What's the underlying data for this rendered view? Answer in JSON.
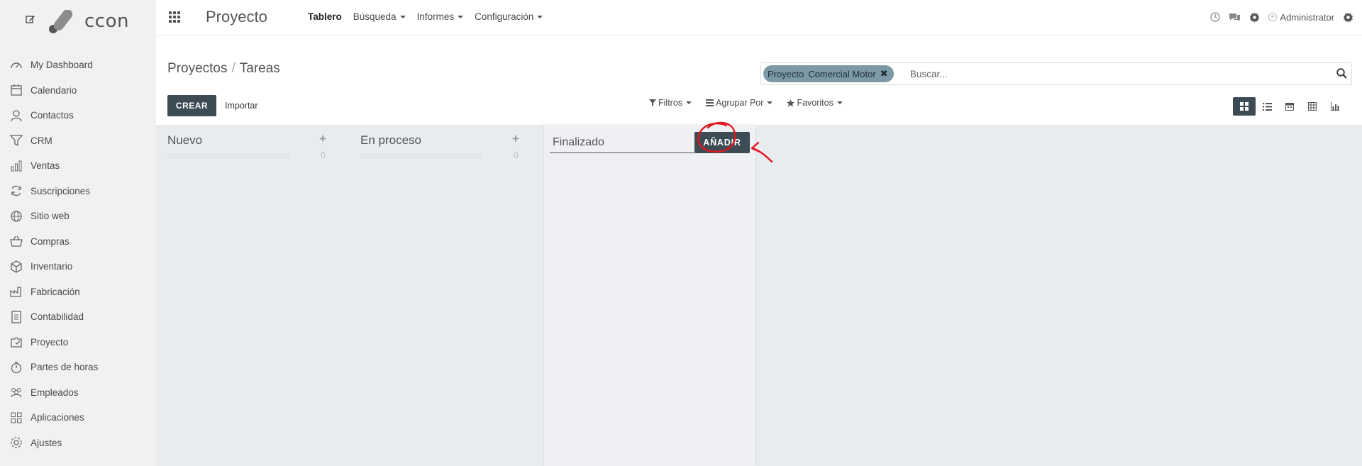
{
  "brand": {
    "logo_text": "ccon"
  },
  "sidebar": {
    "items": [
      {
        "label": "My Dashboard",
        "icon": "dashboard-icon"
      },
      {
        "label": "Calendario",
        "icon": "calendar-icon"
      },
      {
        "label": "Contactos",
        "icon": "user-icon"
      },
      {
        "label": "CRM",
        "icon": "funnel-icon"
      },
      {
        "label": "Ventas",
        "icon": "bar-chart-icon"
      },
      {
        "label": "Suscripciones",
        "icon": "refresh-icon"
      },
      {
        "label": "Sitio web",
        "icon": "globe-icon"
      },
      {
        "label": "Compras",
        "icon": "basket-icon"
      },
      {
        "label": "Inventario",
        "icon": "box-icon"
      },
      {
        "label": "Fabricación",
        "icon": "factory-icon"
      },
      {
        "label": "Contabilidad",
        "icon": "ledger-icon"
      },
      {
        "label": "Proyecto",
        "icon": "puzzle-icon"
      },
      {
        "label": "Partes de horas",
        "icon": "stopwatch-icon"
      },
      {
        "label": "Empleados",
        "icon": "employees-icon"
      },
      {
        "label": "Aplicaciones",
        "icon": "apps-grid-icon"
      },
      {
        "label": "Ajustes",
        "icon": "gear-icon"
      }
    ]
  },
  "topbar": {
    "app_title": "Proyecto",
    "menu": {
      "tablero": "Tablero",
      "busqueda": "Búsqueda",
      "informes": "Informes",
      "configuracion": "Configuración"
    },
    "user": "Administrator"
  },
  "control_panel": {
    "breadcrumb": {
      "parent": "Proyectos",
      "separator": "/",
      "current": "Tareas"
    },
    "search": {
      "facet_title": "Proyecto",
      "facet_value": "Comercial Motor",
      "facet_remove": "✖",
      "placeholder": "Buscar..."
    },
    "create_label": "CREAR",
    "import_label": "Importar",
    "filters_label": "Filtros",
    "group_by_label": "Agrupar Por",
    "favorites_label": "Favoritos"
  },
  "kanban": {
    "columns": [
      {
        "title": "Nuevo",
        "count": "0",
        "add": "+"
      },
      {
        "title": "En proceso",
        "count": "0",
        "add": "+"
      }
    ],
    "new_column": {
      "value": "Finalizado",
      "add_label": "AÑADIR"
    }
  },
  "colors": {
    "primary": "#3d4b55",
    "facet": "#7c9aa6",
    "annotation": "#e0161d"
  }
}
